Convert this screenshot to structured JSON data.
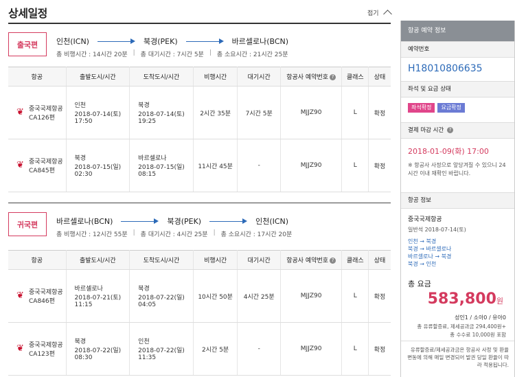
{
  "header": {
    "title": "상세일정",
    "collapse_label": "접기"
  },
  "outbound": {
    "badge": "출국편",
    "cities": [
      "인천(ICN)",
      "북경(PEK)",
      "바르셀로나(BCN)"
    ],
    "total_flight": "총 비행시간 : 14시간 20분",
    "total_wait": "총 대기시간 : 7시간 5분",
    "total_duration": "총 소요시간 : 21시간 25분"
  },
  "inbound": {
    "badge": "귀국편",
    "cities": [
      "바르셀로나(BCN)",
      "북경(PEK)",
      "인천(ICN)"
    ],
    "total_flight": "총 비행시간 : 12시간 55분",
    "total_wait": "총 대기시간 : 4시간 25분",
    "total_duration": "총 소요시간 : 17시간 20분"
  },
  "columns": [
    "항공",
    "출발도시/시간",
    "도착도시/시간",
    "비행시간",
    "대기시간",
    "항공사 예약번호",
    "클래스",
    "상태"
  ],
  "outbound_rows": [
    {
      "airline": "중국국제항공",
      "flight": "CA126편",
      "dep_city": "인천",
      "dep_date": "2018-07-14(토)",
      "dep_time": "17:50",
      "arr_city": "북경",
      "arr_date": "2018-07-14(토)",
      "arr_time": "19:25",
      "flight_time": "2시간 35분",
      "wait": "7시간 5분",
      "pnr": "MJJZ90",
      "class": "L",
      "status": "확정"
    },
    {
      "airline": "중국국제항공",
      "flight": "CA845편",
      "dep_city": "북경",
      "dep_date": "2018-07-15(일)",
      "dep_time": "02:30",
      "arr_city": "바르셀로나",
      "arr_date": "2018-07-15(일)",
      "arr_time": "08:15",
      "flight_time": "11시간 45분",
      "wait": "-",
      "pnr": "MJJZ90",
      "class": "L",
      "status": "확정"
    }
  ],
  "inbound_rows": [
    {
      "airline": "중국국제항공",
      "flight": "CA846편",
      "dep_city": "바르셀로나",
      "dep_date": "2018-07-21(토)",
      "dep_time": "11:15",
      "arr_city": "북경",
      "arr_date": "2018-07-22(일)",
      "arr_time": "04:05",
      "flight_time": "10시간 50분",
      "wait": "4시간 25분",
      "pnr": "MJJZ90",
      "class": "L",
      "status": "확정"
    },
    {
      "airline": "중국국제항공",
      "flight": "CA123편",
      "dep_city": "북경",
      "dep_date": "2018-07-22(일)",
      "dep_time": "08:30",
      "arr_city": "인천",
      "arr_date": "2018-07-22(일)",
      "arr_time": "11:35",
      "flight_time": "2시간 5분",
      "wait": "-",
      "pnr": "MJJZ90",
      "class": "L",
      "status": "확정"
    }
  ],
  "sidebar": {
    "title": "항공 예약 정보",
    "booking_label": "예약번호",
    "booking_no": "H18010806635",
    "seat_label": "좌석 및 요금 상태",
    "chip_seat": "좌석확정",
    "chip_fare": "요금확정",
    "deadline_label": "결제 마감 시간",
    "deadline": "2018-01-09(화) 17:00",
    "notice": "※ 항공사 사정으로 앞당겨질 수 있으니 24시간 이내 재확인 바랍니다.",
    "flight_label": "항공 정보",
    "airline": "중국국제항공",
    "class_line": "일반석   2018-07-14(토)",
    "segments": [
      "인천 → 북경",
      "북경 → 바르셀로나",
      "바르셀로나 → 북경",
      "북경 → 인천"
    ],
    "total_label": "총 요금",
    "total_price": "583,800",
    "won": "원",
    "pax": "성인1 / 소아0 / 유아0",
    "fee1": "총 유류할증료, 제세공과금 294,400원+",
    "fee2": "총 수수료 10,000원 포함",
    "foot": "유류할증료/제세공과금은 항공사 사정 및 환율변동에 의해 매일 변경되어 발권 당일 환율이 따라 적용됩니다."
  },
  "colors": {
    "accent": "#d43a5e",
    "link": "#2c6ab8",
    "logo": "#c8102e"
  }
}
